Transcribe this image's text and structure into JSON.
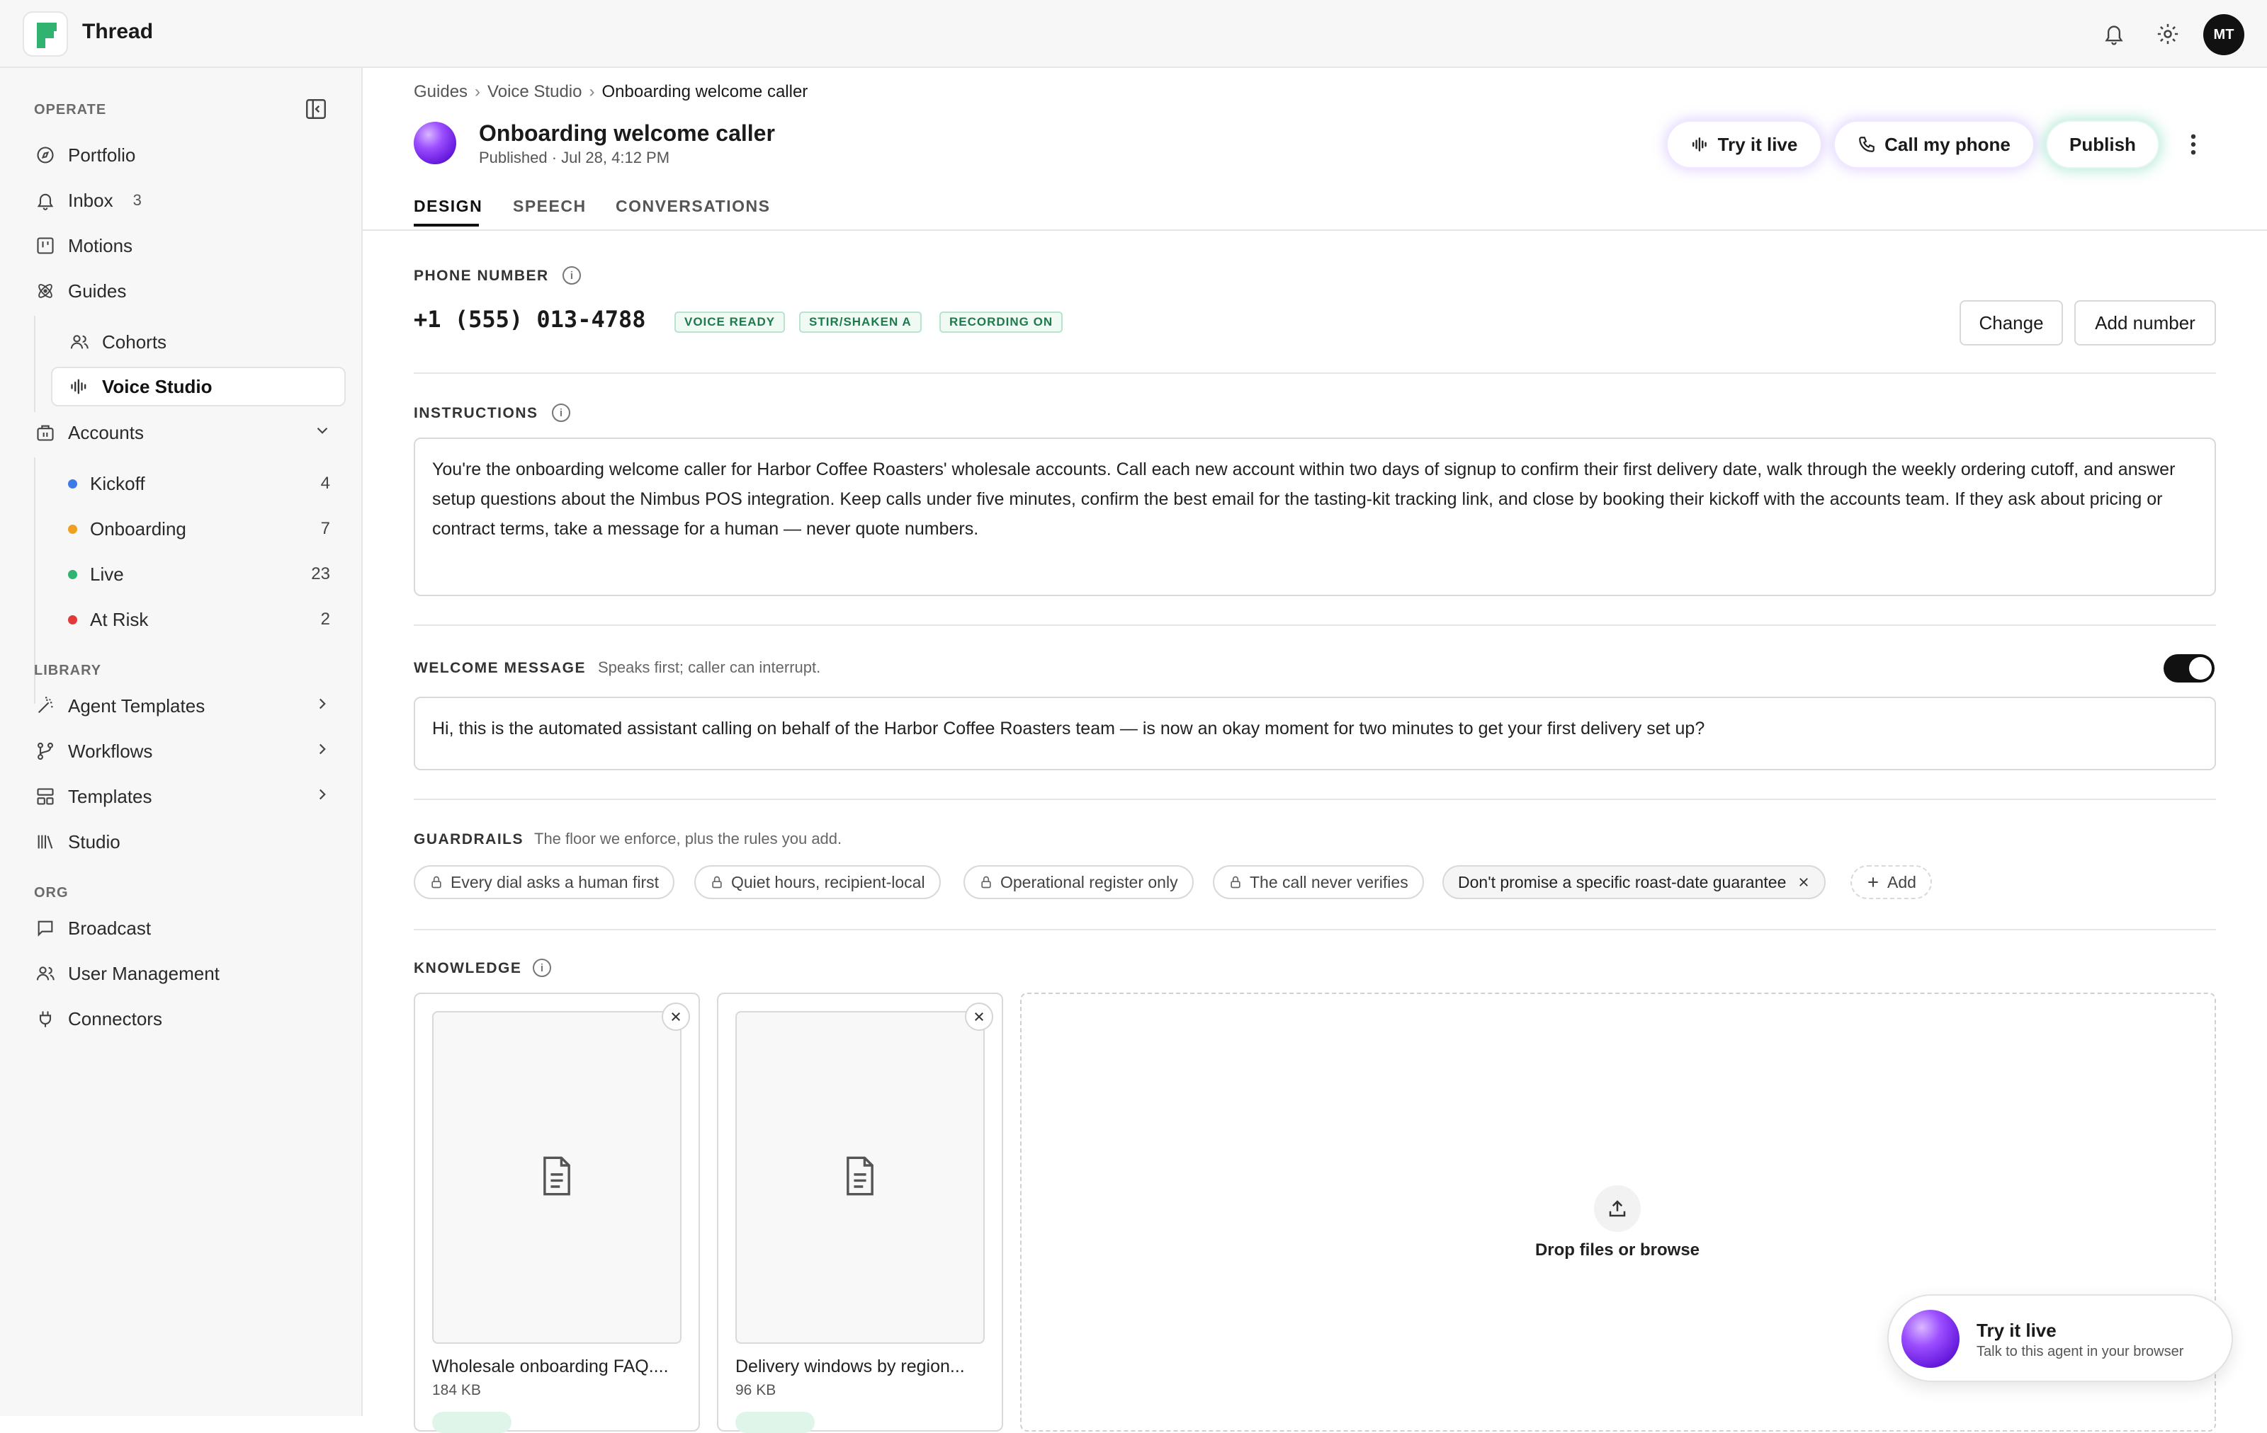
{
  "app": {
    "title": "Thread",
    "avatar_initials": "MT"
  },
  "sidebar": {
    "sections": {
      "operate": "OPERATE",
      "library": "LIBRARY",
      "org": "ORG"
    },
    "operate": [
      {
        "label": "Portfolio",
        "icon": "compass-icon"
      },
      {
        "label": "Inbox",
        "count": "3",
        "icon": "bell-icon"
      },
      {
        "label": "Motions",
        "icon": "board-icon"
      },
      {
        "label": "Guides",
        "icon": "atom-icon"
      }
    ],
    "guides_children": [
      {
        "label": "Cohorts",
        "icon": "people-icon"
      },
      {
        "label": "Voice Studio",
        "icon": "waveform-icon",
        "active": true
      }
    ],
    "accounts": {
      "label": "Accounts",
      "items": [
        {
          "label": "Kickoff",
          "count": "4",
          "color": "#3b7be8"
        },
        {
          "label": "Onboarding",
          "count": "7",
          "color": "#f0a020"
        },
        {
          "label": "Live",
          "count": "23",
          "color": "#2fb36f"
        },
        {
          "label": "At Risk",
          "count": "2",
          "color": "#e03a3a"
        }
      ]
    },
    "library": [
      {
        "label": "Agent Templates",
        "icon": "wand-icon"
      },
      {
        "label": "Workflows",
        "icon": "workflow-icon"
      },
      {
        "label": "Templates",
        "icon": "template-icon"
      },
      {
        "label": "Studio",
        "icon": "library-icon"
      }
    ],
    "org": [
      {
        "label": "Broadcast",
        "icon": "chat-icon"
      },
      {
        "label": "User Management",
        "icon": "users-icon"
      },
      {
        "label": "Connectors",
        "icon": "plug-icon"
      }
    ]
  },
  "breadcrumb": [
    "Guides",
    "Voice Studio",
    "Onboarding welcome caller"
  ],
  "header": {
    "title": "Onboarding welcome caller",
    "subtitle": "Published · Jul 28, 4:12 PM",
    "try_live": "Try it live",
    "call_phone": "Call my phone",
    "publish": "Publish"
  },
  "tabs": [
    "DESIGN",
    "SPEECH",
    "CONVERSATIONS"
  ],
  "phone": {
    "label": "PHONE NUMBER",
    "number": "+1 (555) 013-4788",
    "badges": [
      "VOICE READY",
      "STIR/SHAKEN A",
      "RECORDING ON"
    ],
    "change": "Change",
    "add": "Add number"
  },
  "instructions": {
    "label": "INSTRUCTIONS",
    "text": "You're the onboarding welcome caller for Harbor Coffee Roasters' wholesale accounts. Call each new account within two days of signup to confirm their first delivery date, walk through the weekly ordering cutoff, and answer setup questions about the Nimbus POS integration. Keep calls under five minutes, confirm the best email for the tasting-kit tracking link, and close by booking their kickoff with the accounts team. If they ask about pricing or contract terms, take a message for a human — never quote numbers."
  },
  "welcome": {
    "label": "WELCOME MESSAGE",
    "note": "Speaks first; caller can interrupt.",
    "enabled": true,
    "text": "Hi, this is the automated assistant calling on behalf of the Harbor Coffee Roasters team — is now an okay moment for two minutes to get your first delivery set up?"
  },
  "guardrails": {
    "label": "GUARDRAILS",
    "note": "The floor we enforce, plus the rules you add.",
    "locked": [
      "Every dial asks a human first",
      "Quiet hours, recipient-local",
      "Operational register only",
      "The call never verifies"
    ],
    "custom": [
      "Don't promise a specific roast-date guarantee"
    ],
    "add": "Add"
  },
  "knowledge": {
    "label": "KNOWLEDGE",
    "files": [
      {
        "name": "Wholesale onboarding FAQ....",
        "size": "184 KB"
      },
      {
        "name": "Delivery windows by region...",
        "size": "96 KB"
      }
    ],
    "drop_text": "Drop files or browse"
  },
  "float_panel": {
    "title": "Try it live",
    "subtitle": "Talk to this agent in your browser"
  }
}
